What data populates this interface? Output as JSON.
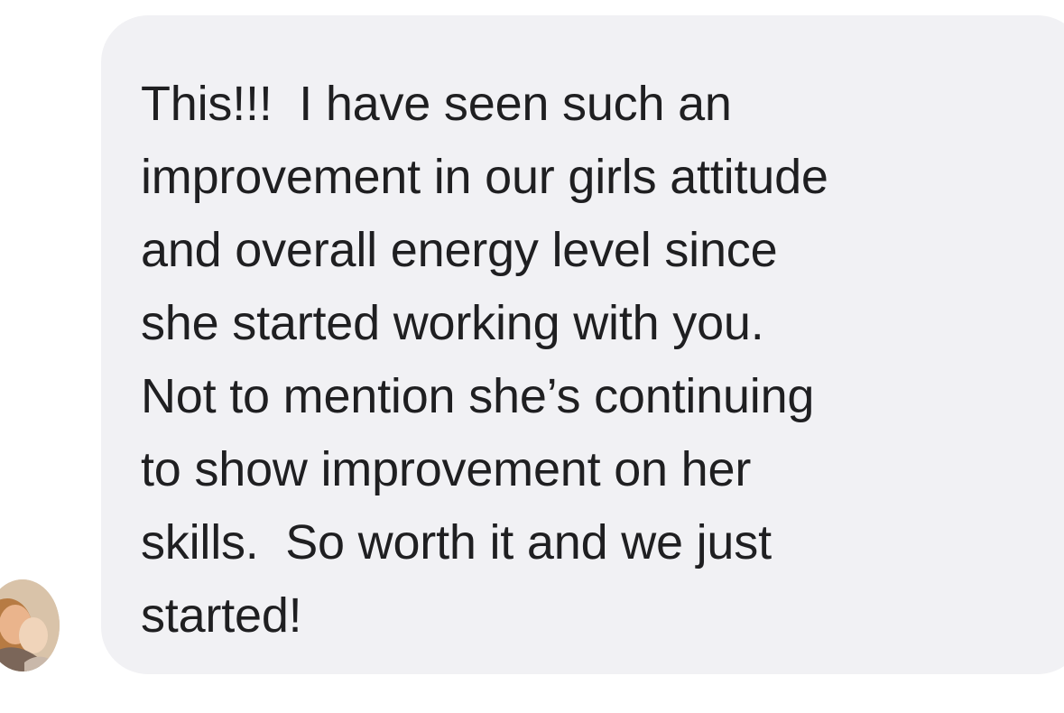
{
  "conversation": {
    "message": {
      "lines": [
        "This!!!  I have seen such an",
        "improvement in our girls attitude",
        "and overall energy level since",
        "she started working with you.",
        "Not to mention she’s continuing",
        "to show improvement on her",
        "skills.  So worth it and we just",
        "started!"
      ],
      "bubble_color": "#f1f1f4",
      "text_color": "#1f1f21"
    },
    "sender": {
      "avatar_icon": "user-photo-avatar-icon"
    }
  }
}
